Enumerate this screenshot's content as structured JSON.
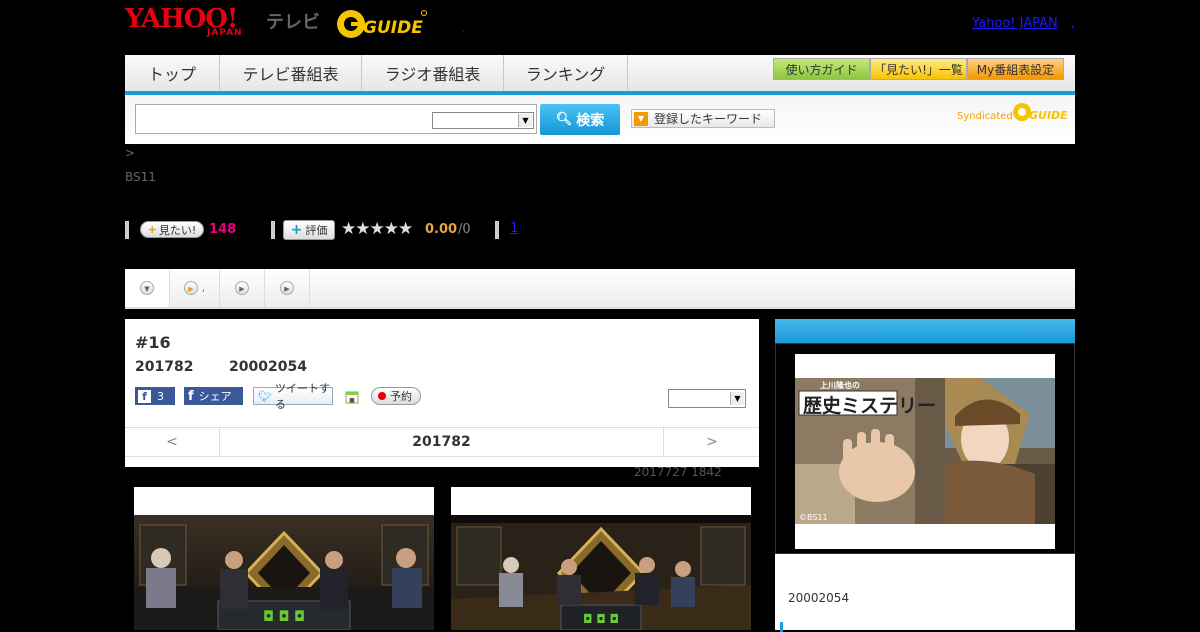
{
  "header": {
    "yahoo_logo": "YAHOO!",
    "japan_logo": "JAPAN",
    "tv_label": "テレビ",
    "gguide_logo": "G-GUIDE",
    "yahoo_japan_link": "Yahoo! JAPAN",
    "separator": ",",
    "dot": "."
  },
  "nav": {
    "tabs": [
      "トップ",
      "テレビ番組表",
      "ラジオ番組表",
      "ランキング"
    ],
    "buttons": [
      "使い方ガイド",
      "「見たい!」一覧",
      "My番組表設定"
    ]
  },
  "search": {
    "input_value": "",
    "select_value": "",
    "button_label": "検索",
    "keyword_button": "登録したキーワード",
    "syndicated": "Syndicated"
  },
  "breadcrumb": ">",
  "channel": "BS11",
  "actions": {
    "want_label": "見たい!",
    "want_count": "148",
    "rate_label": "評価",
    "stars": "★★★★★",
    "rating": "0.00",
    "rating_count": "/0",
    "link": "1"
  },
  "episode": {
    "number": "#16",
    "date": "201782",
    "time": "20002054",
    "fb_count": "3",
    "fb_share": "シェア",
    "tweet": "ツイートする",
    "reserve": "予約",
    "pager_prev": "<",
    "pager_current": "201782",
    "pager_next": ">"
  },
  "updated": "2017727  1842",
  "sidebar": {
    "poster_title": "歴史ミステリー",
    "poster_small": "上川隆也の",
    "poster_credit": "©BS11",
    "time": "20002054"
  },
  "colors": {
    "accent_blue": "#1a9ad9",
    "brand_red": "#e60012",
    "want_pink": "#e4007f",
    "rating_orange": "#e8a33b"
  }
}
